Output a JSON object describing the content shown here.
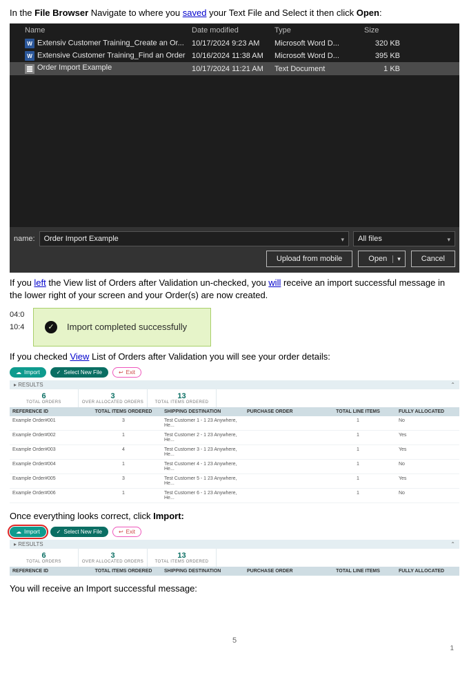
{
  "doc": {
    "step_browser": "In the <b>File Browser</b> Navigate to where you <a>saved</a> your Text File and Select it then click <b>Open</b>:",
    "step_left": "If you <a>left</a> the View list of Orders after Validation un-checked, you <a>will</a> receive an import successful message in the lower right of your screen and your Order(s) are now created.",
    "step_view": "If you checked <a>View</a> List of Orders after Validation you will see your order details:",
    "step_import": "Once everything looks correct, click <b>Import:</b>",
    "step_final": "You will receive an Import successful message:",
    "page_number": "5",
    "slide_number": "1"
  },
  "fb": {
    "headers": {
      "name": "Name",
      "date": "Date modified",
      "type": "Type",
      "size": "Size"
    },
    "rows": [
      {
        "icon": "word",
        "name": "Extensiv Customer Training_Create an Or...",
        "date": "10/17/2024 9:23 AM",
        "type": "Microsoft Word D...",
        "size": "320 KB",
        "selected": false
      },
      {
        "icon": "word",
        "name": "Extensive Customer Training_Find an Order",
        "date": "10/16/2024 11:38 AM",
        "type": "Microsoft Word D...",
        "size": "395 KB",
        "selected": false
      },
      {
        "icon": "text",
        "name": "Order Import Example",
        "date": "10/17/2024 11:21 AM",
        "type": "Text Document",
        "size": "1 KB",
        "selected": true
      }
    ],
    "name_label": "name:",
    "name_value": "Order Import Example",
    "filter": "All files",
    "btn_upload": "Upload from mobile",
    "btn_open": "Open",
    "btn_cancel": "Cancel"
  },
  "toast": {
    "times": [
      "04:0",
      "10:4"
    ],
    "msg": "Import completed successfully"
  },
  "orders1": {
    "btn_import": "Import",
    "btn_select": "Select New File",
    "btn_exit": "Exit",
    "results_label": "RESULTS",
    "stats": [
      {
        "num": "6",
        "lbl": "TOTAL ORDERS"
      },
      {
        "num": "3",
        "lbl": "OVER ALLOCATED ORDERS"
      },
      {
        "num": "13",
        "lbl": "TOTAL ITEMS ORDERED"
      }
    ],
    "headers": {
      "ref": "REFERENCE ID",
      "items": "TOTAL ITEMS ORDERED",
      "dest": "SHIPPING DESTINATION",
      "po": "PURCHASE ORDER",
      "lines": "TOTAL LINE ITEMS",
      "alloc": "FULLY ALLOCATED"
    },
    "rows": [
      {
        "ref": "Example Order#001",
        "items": "3",
        "dest": "Test Customer 1 - 1 23 Anywhere, He...",
        "po": "",
        "lines": "1",
        "alloc": "No"
      },
      {
        "ref": "Example Order#002",
        "items": "1",
        "dest": "Test Customer 2 - 1 23 Anywhere, He...",
        "po": "",
        "lines": "1",
        "alloc": "Yes"
      },
      {
        "ref": "Example Order#003",
        "items": "4",
        "dest": "Test Customer 3 - 1 23 Anywhere, He...",
        "po": "",
        "lines": "1",
        "alloc": "Yes"
      },
      {
        "ref": "Example Order#004",
        "items": "1",
        "dest": "Test Customer 4 - 1 23 Anywhere, He...",
        "po": "",
        "lines": "1",
        "alloc": "No"
      },
      {
        "ref": "Example Order#005",
        "items": "3",
        "dest": "Test Customer 5 - 1 23 Anywhere, He...",
        "po": "",
        "lines": "1",
        "alloc": "Yes"
      },
      {
        "ref": "Example Order#006",
        "items": "1",
        "dest": "Test Customer 6 - 1 23 Anywhere, He...",
        "po": "",
        "lines": "1",
        "alloc": "No"
      }
    ]
  },
  "orders2": {
    "btn_import": "Import",
    "btn_select": "Select New File",
    "btn_exit": "Exit",
    "results_label": "RESULTS",
    "stats": [
      {
        "num": "6",
        "lbl": "TOTAL ORDERS"
      },
      {
        "num": "3",
        "lbl": "OVER ALLOCATED ORDERS"
      },
      {
        "num": "13",
        "lbl": "TOTAL ITEMS ORDERED"
      }
    ],
    "headers": {
      "ref": "REFERENCE  ID",
      "items": "TOTAL ITEMS ORDERED",
      "dest": "SHIPPING  DESTINATION",
      "po": "PURCHASE ORDER",
      "lines": "TOTAL LINE ITEMS",
      "alloc": "FULLY ALLOCATED"
    }
  }
}
